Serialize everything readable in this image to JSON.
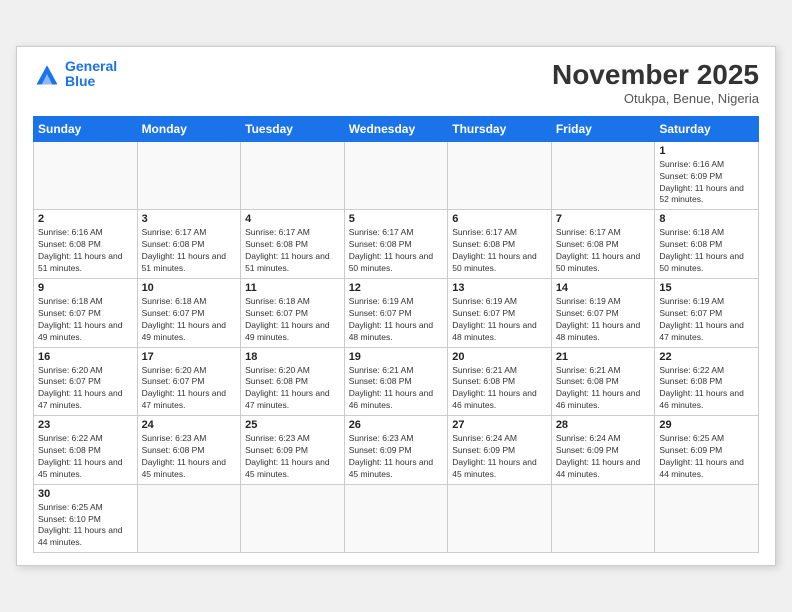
{
  "header": {
    "logo_general": "General",
    "logo_blue": "Blue",
    "month_title": "November 2025",
    "location": "Otukpa, Benue, Nigeria"
  },
  "days_of_week": [
    "Sunday",
    "Monday",
    "Tuesday",
    "Wednesday",
    "Thursday",
    "Friday",
    "Saturday"
  ],
  "weeks": [
    [
      {
        "day": "",
        "text": ""
      },
      {
        "day": "",
        "text": ""
      },
      {
        "day": "",
        "text": ""
      },
      {
        "day": "",
        "text": ""
      },
      {
        "day": "",
        "text": ""
      },
      {
        "day": "",
        "text": ""
      },
      {
        "day": "1",
        "text": "Sunrise: 6:16 AM\nSunset: 6:09 PM\nDaylight: 11 hours and 52 minutes."
      }
    ],
    [
      {
        "day": "2",
        "text": "Sunrise: 6:16 AM\nSunset: 6:08 PM\nDaylight: 11 hours and 51 minutes."
      },
      {
        "day": "3",
        "text": "Sunrise: 6:17 AM\nSunset: 6:08 PM\nDaylight: 11 hours and 51 minutes."
      },
      {
        "day": "4",
        "text": "Sunrise: 6:17 AM\nSunset: 6:08 PM\nDaylight: 11 hours and 51 minutes."
      },
      {
        "day": "5",
        "text": "Sunrise: 6:17 AM\nSunset: 6:08 PM\nDaylight: 11 hours and 50 minutes."
      },
      {
        "day": "6",
        "text": "Sunrise: 6:17 AM\nSunset: 6:08 PM\nDaylight: 11 hours and 50 minutes."
      },
      {
        "day": "7",
        "text": "Sunrise: 6:17 AM\nSunset: 6:08 PM\nDaylight: 11 hours and 50 minutes."
      },
      {
        "day": "8",
        "text": "Sunrise: 6:18 AM\nSunset: 6:08 PM\nDaylight: 11 hours and 50 minutes."
      }
    ],
    [
      {
        "day": "9",
        "text": "Sunrise: 6:18 AM\nSunset: 6:07 PM\nDaylight: 11 hours and 49 minutes."
      },
      {
        "day": "10",
        "text": "Sunrise: 6:18 AM\nSunset: 6:07 PM\nDaylight: 11 hours and 49 minutes."
      },
      {
        "day": "11",
        "text": "Sunrise: 6:18 AM\nSunset: 6:07 PM\nDaylight: 11 hours and 49 minutes."
      },
      {
        "day": "12",
        "text": "Sunrise: 6:19 AM\nSunset: 6:07 PM\nDaylight: 11 hours and 48 minutes."
      },
      {
        "day": "13",
        "text": "Sunrise: 6:19 AM\nSunset: 6:07 PM\nDaylight: 11 hours and 48 minutes."
      },
      {
        "day": "14",
        "text": "Sunrise: 6:19 AM\nSunset: 6:07 PM\nDaylight: 11 hours and 48 minutes."
      },
      {
        "day": "15",
        "text": "Sunrise: 6:19 AM\nSunset: 6:07 PM\nDaylight: 11 hours and 47 minutes."
      }
    ],
    [
      {
        "day": "16",
        "text": "Sunrise: 6:20 AM\nSunset: 6:07 PM\nDaylight: 11 hours and 47 minutes."
      },
      {
        "day": "17",
        "text": "Sunrise: 6:20 AM\nSunset: 6:07 PM\nDaylight: 11 hours and 47 minutes."
      },
      {
        "day": "18",
        "text": "Sunrise: 6:20 AM\nSunset: 6:08 PM\nDaylight: 11 hours and 47 minutes."
      },
      {
        "day": "19",
        "text": "Sunrise: 6:21 AM\nSunset: 6:08 PM\nDaylight: 11 hours and 46 minutes."
      },
      {
        "day": "20",
        "text": "Sunrise: 6:21 AM\nSunset: 6:08 PM\nDaylight: 11 hours and 46 minutes."
      },
      {
        "day": "21",
        "text": "Sunrise: 6:21 AM\nSunset: 6:08 PM\nDaylight: 11 hours and 46 minutes."
      },
      {
        "day": "22",
        "text": "Sunrise: 6:22 AM\nSunset: 6:08 PM\nDaylight: 11 hours and 46 minutes."
      }
    ],
    [
      {
        "day": "23",
        "text": "Sunrise: 6:22 AM\nSunset: 6:08 PM\nDaylight: 11 hours and 45 minutes."
      },
      {
        "day": "24",
        "text": "Sunrise: 6:23 AM\nSunset: 6:08 PM\nDaylight: 11 hours and 45 minutes."
      },
      {
        "day": "25",
        "text": "Sunrise: 6:23 AM\nSunset: 6:09 PM\nDaylight: 11 hours and 45 minutes."
      },
      {
        "day": "26",
        "text": "Sunrise: 6:23 AM\nSunset: 6:09 PM\nDaylight: 11 hours and 45 minutes."
      },
      {
        "day": "27",
        "text": "Sunrise: 6:24 AM\nSunset: 6:09 PM\nDaylight: 11 hours and 45 minutes."
      },
      {
        "day": "28",
        "text": "Sunrise: 6:24 AM\nSunset: 6:09 PM\nDaylight: 11 hours and 44 minutes."
      },
      {
        "day": "29",
        "text": "Sunrise: 6:25 AM\nSunset: 6:09 PM\nDaylight: 11 hours and 44 minutes."
      }
    ],
    [
      {
        "day": "30",
        "text": "Sunrise: 6:25 AM\nSunset: 6:10 PM\nDaylight: 11 hours and 44 minutes."
      },
      {
        "day": "",
        "text": ""
      },
      {
        "day": "",
        "text": ""
      },
      {
        "day": "",
        "text": ""
      },
      {
        "day": "",
        "text": ""
      },
      {
        "day": "",
        "text": ""
      },
      {
        "day": "",
        "text": ""
      }
    ]
  ]
}
